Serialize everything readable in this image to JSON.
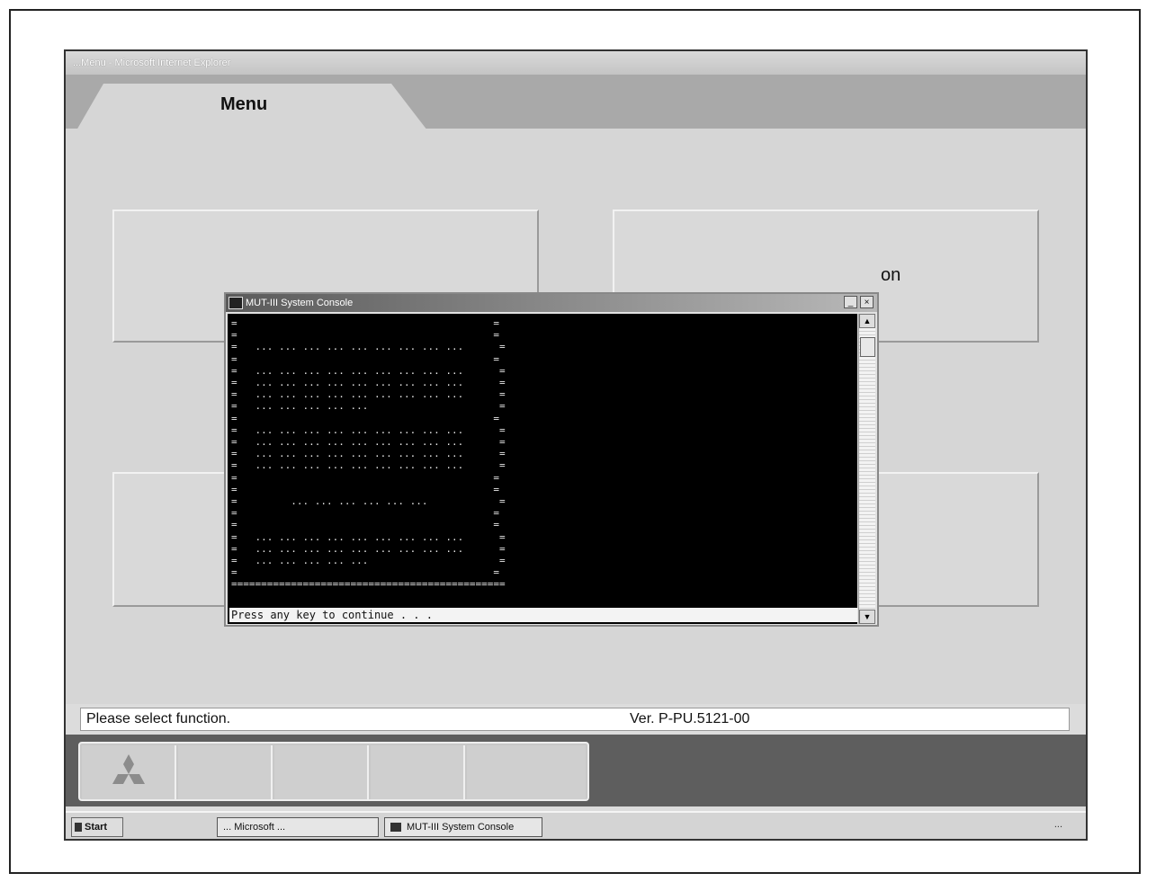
{
  "window": {
    "title": "...Menu - Microsoft Internet Explorer"
  },
  "tabs": [
    {
      "label": "Menu"
    }
  ],
  "panels": {
    "top_right_text": "on"
  },
  "console": {
    "title": "MUT-III System Console",
    "min_label": "_",
    "close_label": "×",
    "lines": [
      "=                                           =",
      "=                                           =",
      "=   ... ... ... ... ... ... ... ... ...      =",
      "=                                           =",
      "=   ... ... ... ... ... ... ... ... ...      =",
      "=   ... ... ... ... ... ... ... ... ...      =",
      "=   ... ... ... ... ... ... ... ... ...      =",
      "=   ... ... ... ... ...                      =",
      "=                                           =",
      "=   ... ... ... ... ... ... ... ... ...      =",
      "=   ... ... ... ... ... ... ... ... ...      =",
      "=   ... ... ... ... ... ... ... ... ...      =",
      "=   ... ... ... ... ... ... ... ... ...      =",
      "=                                           =",
      "=                                           =",
      "=         ... ... ... ... ... ...            =",
      "=                                           =",
      "=                                           =",
      "=   ... ... ... ... ... ... ... ... ...      =",
      "=   ... ... ... ... ... ... ... ... ...      =",
      "=   ... ... ... ... ...                      =",
      "=                                           =",
      "=============================================="
    ],
    "prompt": "Press any key to continue . . ."
  },
  "status": {
    "left": "Please select function.",
    "right": "Ver. P-PU.5121-00"
  },
  "taskbar": {
    "start": "Start",
    "items": [
      {
        "label": "... Microsoft ..."
      },
      {
        "label": "MUT-III System Console"
      }
    ],
    "clock": "..."
  },
  "icons": {
    "logo": "mitsubishi-logo-icon"
  }
}
